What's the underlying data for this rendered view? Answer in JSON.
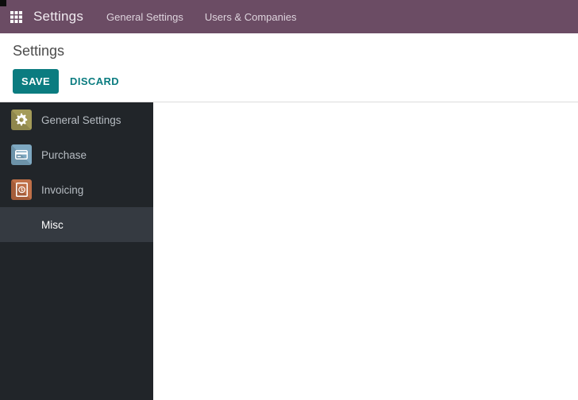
{
  "nav": {
    "title": "Settings",
    "menu_items": [
      "General Settings",
      "Users & Companies"
    ]
  },
  "control_panel": {
    "title": "Settings",
    "save_label": "SAVE",
    "discard_label": "DISCARD"
  },
  "sidebar": {
    "items": [
      {
        "label": "General Settings",
        "icon": "gear-icon",
        "selected": false
      },
      {
        "label": "Purchase",
        "icon": "credit-card-icon",
        "selected": false
      },
      {
        "label": "Invoicing",
        "icon": "invoice-document-icon",
        "selected": false
      },
      {
        "label": "Misc",
        "icon": null,
        "selected": true
      }
    ]
  },
  "colors": {
    "navbar-bg": "#6b4c64",
    "primary": "#0b7c80",
    "sidebar-bg": "#212529",
    "sidebar-selected-bg": "#353a41",
    "sidebar-text": "#b6bcc2",
    "heading-text": "#4c4c4c",
    "panel-border": "#dcdcdc",
    "icon-gold": "#a49b59",
    "icon-gold-dark": "#8f874d",
    "icon-blue": "#7ea8c1",
    "icon-blue-dark": "#6d93a9",
    "icon-rust": "#bf7048",
    "icon-rust-dark": "#a55d3a"
  }
}
